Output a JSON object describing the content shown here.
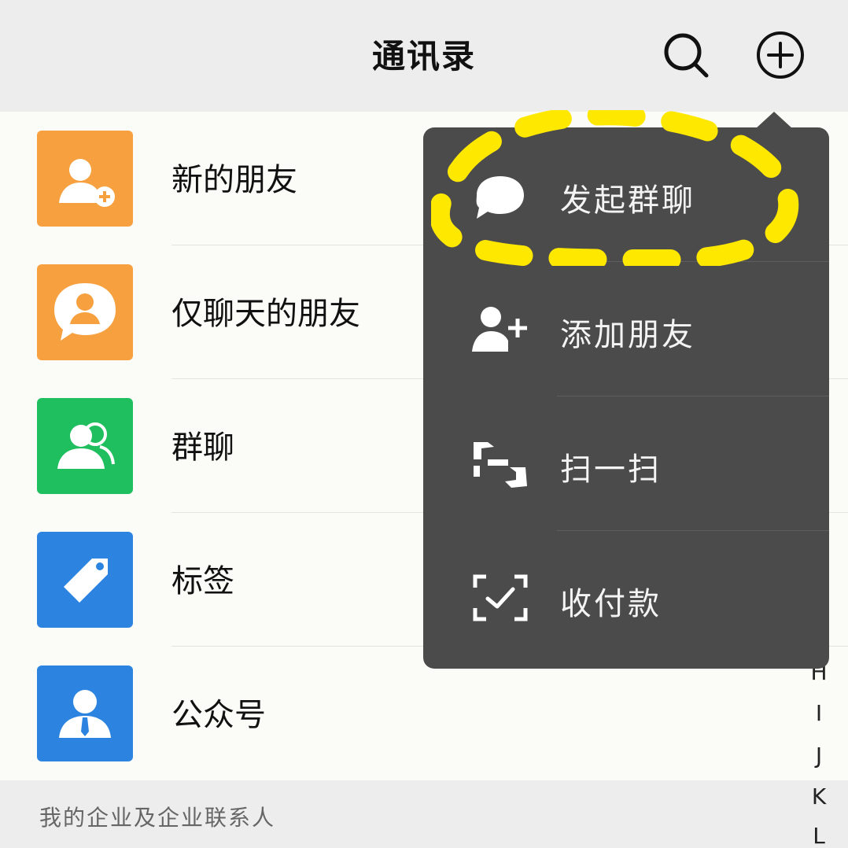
{
  "header": {
    "title": "通讯录"
  },
  "contacts": [
    {
      "label": "新的朋友",
      "icon": "new-friend-icon",
      "color": "#f7a040"
    },
    {
      "label": "仅聊天的朋友",
      "icon": "chat-only-friend-icon",
      "color": "#f7a040"
    },
    {
      "label": "群聊",
      "icon": "group-chat-icon",
      "color": "#1fbf5f"
    },
    {
      "label": "标签",
      "icon": "tag-icon",
      "color": "#2c84e0"
    },
    {
      "label": "公众号",
      "icon": "official-account-icon",
      "color": "#2c84e0"
    }
  ],
  "section": {
    "label": "我的企业及企业联系人"
  },
  "index": [
    "H",
    "I",
    "J",
    "K",
    "L"
  ],
  "menu": {
    "items": [
      {
        "label": "发起群聊",
        "icon": "chat-bubble-icon"
      },
      {
        "label": "添加朋友",
        "icon": "add-friend-icon"
      },
      {
        "label": "扫一扫",
        "icon": "scan-icon"
      },
      {
        "label": "收付款",
        "icon": "payment-icon"
      }
    ]
  },
  "colors": {
    "header_bg": "#ededed",
    "menu_bg": "#4b4b4b",
    "highlight": "#ffe800"
  }
}
